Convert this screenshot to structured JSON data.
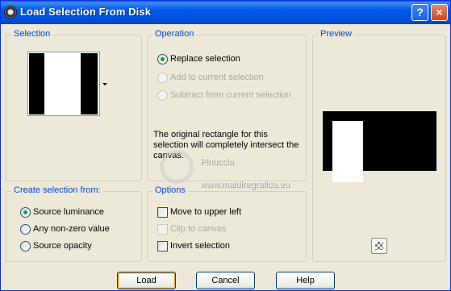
{
  "window": {
    "title": "Load Selection From Disk",
    "help_label": "?",
    "close_label": "×"
  },
  "selection_group": {
    "legend": "Selection"
  },
  "operation_group": {
    "legend": "Operation",
    "options": [
      {
        "label": "Replace selection",
        "checked": true,
        "enabled": true
      },
      {
        "label": "Add to current selection",
        "checked": false,
        "enabled": false
      },
      {
        "label": "Subtract from current selection",
        "checked": false,
        "enabled": false
      }
    ],
    "info": "The original rectangle for this selection will completely intersect the canvas."
  },
  "preview_group": {
    "legend": "Preview"
  },
  "create_group": {
    "legend": "Create selection from:",
    "options": [
      {
        "label": "Source luminance",
        "checked": true
      },
      {
        "label": "Any non-zero value",
        "checked": false
      },
      {
        "label": "Source opacity",
        "checked": false
      }
    ]
  },
  "options_group": {
    "legend": "Options",
    "options": [
      {
        "label": "Move to upper left",
        "checked": false,
        "enabled": true
      },
      {
        "label": "Clip to canvas",
        "checked": false,
        "enabled": false
      },
      {
        "label": "Invert selection",
        "checked": false,
        "enabled": true
      }
    ]
  },
  "buttons": {
    "load": "Load",
    "cancel": "Cancel",
    "help": "Help"
  },
  "watermark": {
    "name": "Pinuccia",
    "url": "www.maidiregrafica.eu"
  },
  "colors": {
    "title_bar": "#0058e6",
    "legend_text": "#0046d5",
    "dialog_bg": "#ece9d8"
  }
}
